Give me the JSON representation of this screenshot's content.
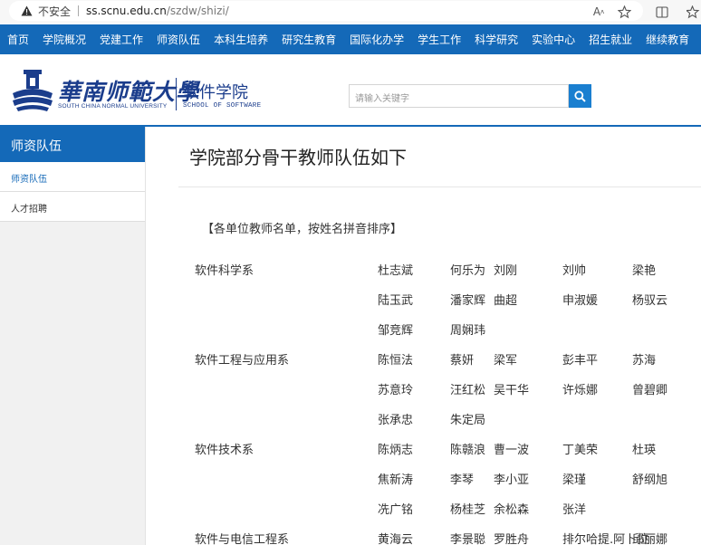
{
  "browser": {
    "insecure_label": "不安全",
    "url_host": "ss.scnu.edu.cn",
    "url_path": "/szdw/shizi/"
  },
  "nav": [
    "首页",
    "学院概况",
    "党建工作",
    "师资队伍",
    "本科生培养",
    "研究生教育",
    "国际化办学",
    "学生工作",
    "科学研究",
    "实验中心",
    "招生就业",
    "继续教育"
  ],
  "header": {
    "logo_cn": "華南师範大學",
    "logo_en": "SOUTH CHINA NORMAL UNIVERSITY",
    "school_cn": "软件学院",
    "school_en": "SCHOOL OF SOFTWARE",
    "search_placeholder": "请输入关键字"
  },
  "sidebar": {
    "title": "师资队伍",
    "items": [
      "师资队伍",
      "人才招聘"
    ]
  },
  "main": {
    "title": "学院部分骨干教师队伍如下",
    "intro": "【各单位教师名单，按姓名拼音排序】",
    "rows": [
      [
        "软件科学系",
        "杜志斌",
        "何乐为",
        "刘刚",
        "刘帅",
        "梁艳"
      ],
      [
        "",
        "陆玉武",
        "潘家辉",
        "曲超",
        "申淑媛",
        "杨驭云"
      ],
      [
        "",
        "邹竞辉",
        "周娴玮",
        "",
        "",
        ""
      ],
      [
        "软件工程与应用系",
        "陈恒法",
        "蔡妍",
        "梁军",
        "彭丰平",
        "苏海"
      ],
      [
        "",
        "苏意玲",
        "汪红松",
        "吴干华",
        "许烁娜",
        "曾碧卿"
      ],
      [
        "",
        "张承忠",
        "朱定局",
        "",
        "",
        ""
      ],
      [
        "软件技术系",
        "陈炳志",
        "陈赣浪",
        "曹一波",
        "丁美荣",
        "杜瑛"
      ],
      [
        "",
        "焦新涛",
        "李琴",
        "李小亚",
        "梁瑾",
        "舒纲旭"
      ],
      [
        "",
        "冼广铭",
        "杨桂芝",
        "余松森",
        "张洋",
        ""
      ],
      [
        "软件与电信工程系",
        "黄海云",
        "李景聪",
        "罗胜舟",
        "排尔哈提.阿卜拉",
        "邱丽娜"
      ]
    ]
  }
}
